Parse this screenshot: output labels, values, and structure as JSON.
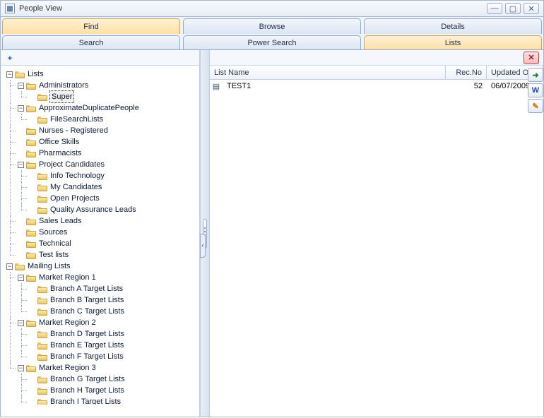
{
  "window": {
    "title": "People View"
  },
  "tabs_top": [
    {
      "label": "Find",
      "active": true
    },
    {
      "label": "Browse",
      "active": false
    },
    {
      "label": "Details",
      "active": false
    }
  ],
  "tabs_sub": [
    {
      "label": "Search",
      "active": false
    },
    {
      "label": "Power Search",
      "active": false
    },
    {
      "label": "Lists",
      "active": true
    }
  ],
  "tree": {
    "root1": {
      "label": "Lists",
      "children": [
        {
          "label": "Administrators",
          "open": true,
          "children": [
            {
              "label": "Super",
              "selected": true
            }
          ]
        },
        {
          "label": "ApproximateDuplicatePeople",
          "open": true,
          "children": [
            {
              "label": "FileSearchLists"
            }
          ]
        },
        {
          "label": "Nurses - Registered"
        },
        {
          "label": "Office Skills"
        },
        {
          "label": "Pharmacists"
        },
        {
          "label": "Project Candidates",
          "open": true,
          "children": [
            {
              "label": "Info Technology"
            },
            {
              "label": "My Candidates"
            },
            {
              "label": "Open Projects"
            },
            {
              "label": "Quality Assurance Leads"
            }
          ]
        },
        {
          "label": "Sales Leads"
        },
        {
          "label": "Sources"
        },
        {
          "label": "Technical"
        },
        {
          "label": "Test lists"
        }
      ]
    },
    "root2": {
      "label": "Mailing Lists",
      "children": [
        {
          "label": "Market Region 1",
          "open": true,
          "children": [
            {
              "label": "Branch A Target Lists"
            },
            {
              "label": "Branch B Target Lists"
            },
            {
              "label": "Branch C Target Lists"
            }
          ]
        },
        {
          "label": "Market Region 2",
          "open": true,
          "children": [
            {
              "label": "Branch D Target Lists"
            },
            {
              "label": "Branch E Target Lists"
            },
            {
              "label": "Branch F Target Lists"
            }
          ]
        },
        {
          "label": "Market Region 3",
          "open": true,
          "children": [
            {
              "label": "Branch G Target Lists"
            },
            {
              "label": "Branch H Target Lists"
            },
            {
              "label": "Branch I Target Lists"
            }
          ]
        }
      ]
    }
  },
  "grid": {
    "columns": {
      "name": "List Name",
      "rec": "Rec.No",
      "updated": "Updated On"
    },
    "rows": [
      {
        "name": "TEST1",
        "rec": "52",
        "updated": "06/07/2009"
      }
    ]
  },
  "icons": {
    "add": "+",
    "delete": "✕",
    "export": "➜",
    "word": "W",
    "open": "✎",
    "min": "—",
    "max": "▢",
    "close": "✕",
    "collapse": "‹"
  }
}
